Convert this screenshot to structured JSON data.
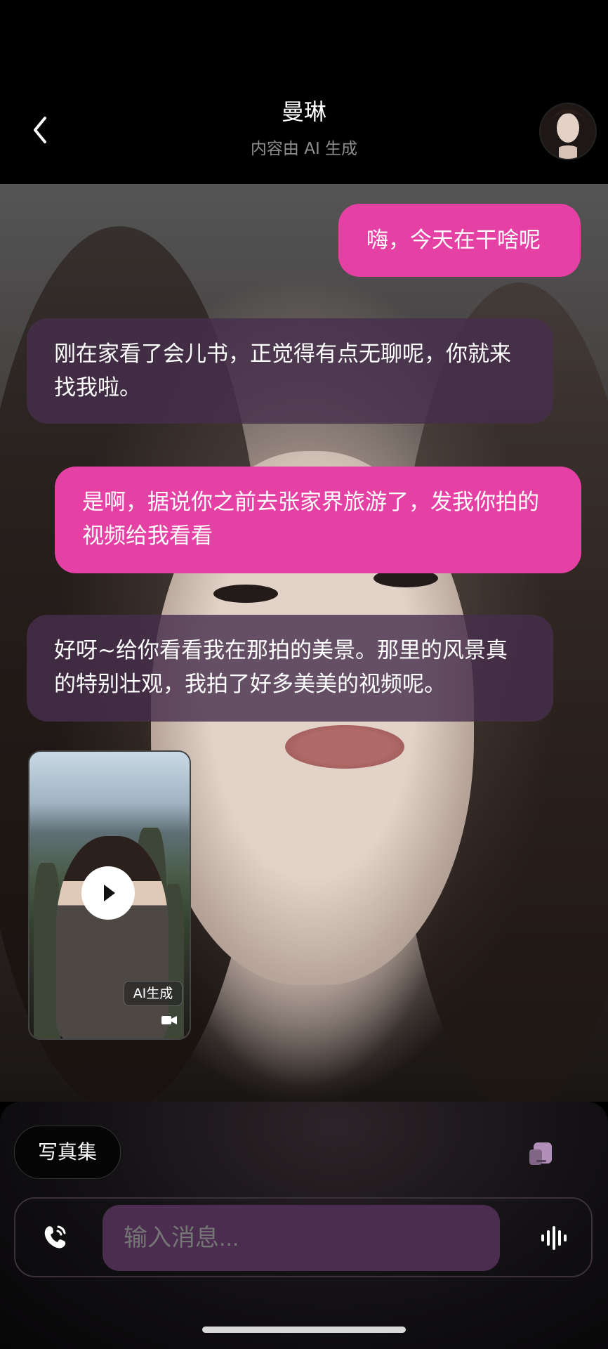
{
  "header": {
    "title": "曼琳",
    "subtitle": "内容由 AI 生成"
  },
  "messages": [
    {
      "role": "user",
      "text": "嗨，今天在干啥呢"
    },
    {
      "role": "ai",
      "text": "刚在家看了会儿书，正觉得有点无聊呢，你就来找我啦。"
    },
    {
      "role": "user",
      "text": "是啊，据说你之前去张家界旅游了，发我你拍的视频给我看看"
    },
    {
      "role": "ai",
      "text": "好呀~给你看看我在那拍的美景。那里的风景真的特别壮观，我拍了好多美美的视频呢。"
    }
  ],
  "video": {
    "tag": "AI生成",
    "icons": [
      "play-icon",
      "video-camera-icon"
    ]
  },
  "bottom": {
    "album_button": "写真集",
    "input_placeholder": "输入消息...",
    "icons": [
      "back-chevron-icon",
      "card-icon",
      "phone-icon",
      "voice-wave-icon"
    ]
  },
  "colors": {
    "user_bubble": "#e541a4",
    "ai_bubble": "#462e4c",
    "input_field": "#4a2d4f"
  }
}
